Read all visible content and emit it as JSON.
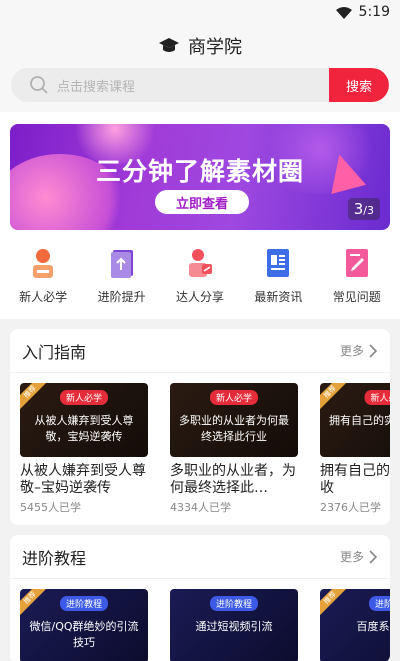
{
  "status": {
    "time": "5:19"
  },
  "header": {
    "title": "商学院"
  },
  "search": {
    "placeholder": "点击搜索课程",
    "button": "搜索"
  },
  "banner": {
    "headline": "三分钟了解素材圈",
    "cta": "立即查看",
    "page_current": "3",
    "page_total": "/3"
  },
  "quick_links": [
    {
      "label": "新人必学",
      "icon": "newcomer-icon",
      "color": "#f36b3c"
    },
    {
      "label": "进阶提升",
      "icon": "advance-book-icon",
      "color": "#7d45d8"
    },
    {
      "label": "达人分享",
      "icon": "expert-share-icon",
      "color": "#f2515c"
    },
    {
      "label": "最新资讯",
      "icon": "news-icon",
      "color": "#3d6ee8"
    },
    {
      "label": "常见问题",
      "icon": "faq-icon",
      "color": "#f25a9a"
    }
  ],
  "sections": [
    {
      "title": "入门指南",
      "more": "更多",
      "cards": [
        {
          "tag": "新人必学",
          "thumb_title": "从被人嫌弃到受人尊敬，宝妈逆袭传",
          "name": "从被人嫌弃到受人尊敬–宝妈逆袭传",
          "count": "5455人已学"
        },
        {
          "tag": "新人必学",
          "thumb_title": "多职业的从业者为何最终选择此行业",
          "name": "多职业的从业者，为何最终选择此…",
          "count": "4334人已学"
        },
        {
          "tag": "新人必",
          "thumb_title": "拥有自己的实现经济收",
          "name": "拥有自己的实现经济收",
          "count": "2376人已学"
        }
      ]
    },
    {
      "title": "进阶教程",
      "more": "更多",
      "cards": [
        {
          "tag": "进阶教程",
          "thumb_title": "微信/QQ群绝妙的引流技巧"
        },
        {
          "tag": "进阶教程",
          "thumb_title": "通过短视频引流"
        },
        {
          "tag": "进阶",
          "thumb_title": "百度系引流"
        }
      ]
    }
  ],
  "corner_badge": "推荐"
}
